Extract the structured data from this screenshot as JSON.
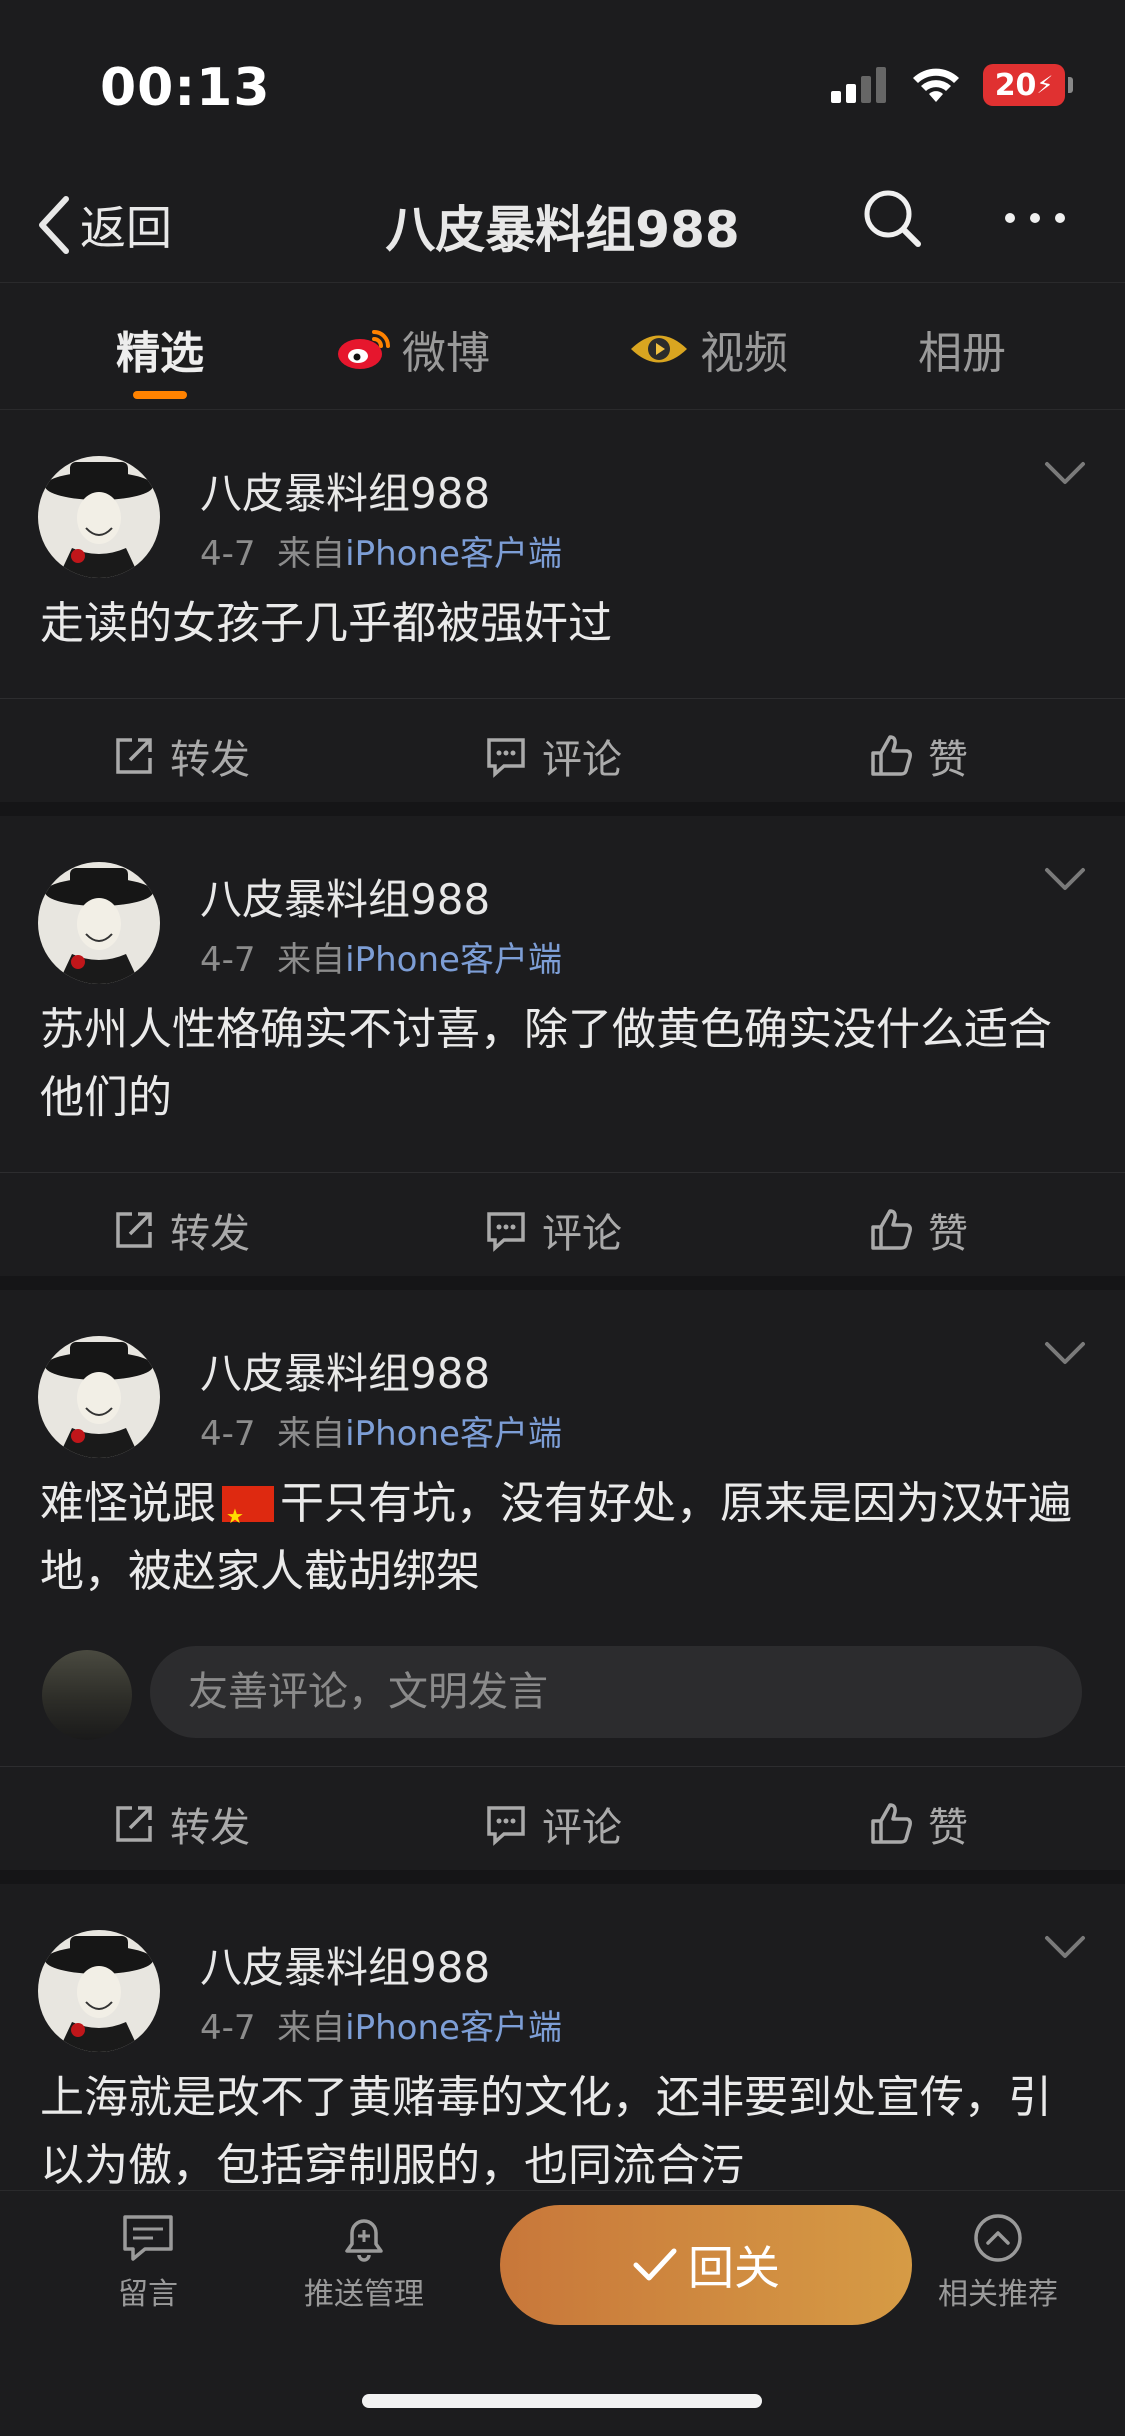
{
  "status_bar": {
    "time": "00:13",
    "battery": "20"
  },
  "nav": {
    "back_label": "返回",
    "title": "八皮暴料组988"
  },
  "tabs": [
    {
      "label": "精选",
      "icon": "none",
      "active": true
    },
    {
      "label": "微博",
      "icon": "weibo-icon",
      "active": false
    },
    {
      "label": "视频",
      "icon": "video-eye-icon",
      "active": false
    },
    {
      "label": "相册",
      "icon": "none",
      "active": false
    }
  ],
  "posts": [
    {
      "author": "八皮暴料组988",
      "date": "4-7",
      "from": "来自",
      "source": "iPhone客户端",
      "text": "走读的女孩子几乎都被强奸过"
    },
    {
      "author": "八皮暴料组988",
      "date": "4-7",
      "from": "来自",
      "source": "iPhone客户端",
      "text": "苏州人性格确实不讨喜，除了做黄色确实没什么适合他们的"
    },
    {
      "author": "八皮暴料组988",
      "date": "4-7",
      "from": "来自",
      "source": "iPhone客户端",
      "text_before_flag": "难怪说跟",
      "text_after_flag": "干只有坑，没有好处，原来是因为汉奸遍地，被赵家人截胡绑架",
      "comment_placeholder": "友善评论，文明发言"
    },
    {
      "author": "八皮暴料组988",
      "date": "4-7",
      "from": "来自",
      "source": "iPhone客户端",
      "text": "上海就是改不了黄赌毒的文化，还非要到处宣传，引以为傲，包括穿制服的，也同流合污"
    }
  ],
  "actions": {
    "repost": "转发",
    "comment": "评论",
    "like": "赞"
  },
  "bottom_bar": {
    "message": "留言",
    "push": "推送管理",
    "cta": "回关",
    "recommend": "相关推荐"
  },
  "colors": {
    "accent": "#ff8200",
    "source_link": "#7d9ed6",
    "background": "#1c1c1e"
  }
}
